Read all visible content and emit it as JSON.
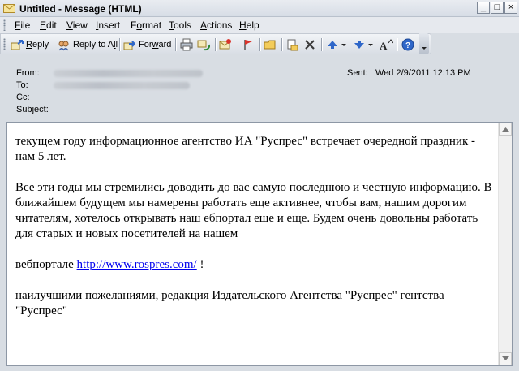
{
  "window": {
    "title": "Untitled - Message (HTML)",
    "controls": {
      "minimize": "_",
      "maximize": "□",
      "close": "×"
    }
  },
  "menu": {
    "items": [
      {
        "pre": "",
        "key": "F",
        "post": "ile"
      },
      {
        "pre": "",
        "key": "E",
        "post": "dit"
      },
      {
        "pre": "",
        "key": "V",
        "post": "iew"
      },
      {
        "pre": "",
        "key": "I",
        "post": "nsert"
      },
      {
        "pre": "F",
        "key": "o",
        "post": "rmat"
      },
      {
        "pre": "",
        "key": "T",
        "post": "ools"
      },
      {
        "pre": "",
        "key": "A",
        "post": "ctions"
      },
      {
        "pre": "",
        "key": "H",
        "post": "elp"
      }
    ]
  },
  "toolbar": {
    "reply": {
      "pre": "",
      "key": "R",
      "post": "eply"
    },
    "reply_all": {
      "pre": "Reply to A",
      "key": "l",
      "post": "l"
    },
    "forward": {
      "pre": "For",
      "key": "w",
      "post": "ard"
    }
  },
  "header": {
    "from_label": "From:",
    "to_label": "To:",
    "cc_label": "Cc:",
    "subject_label": "Subject:",
    "sent_label": "Sent:",
    "sent_value": "Wed 2/9/2011 12:13 PM"
  },
  "body": {
    "p1": "текущем году информационное агентство ИА \"Руспрес\" встречает очередной праздник - нам 5 лет.",
    "p2": "Все эти годы мы стремились доводить до вас самую последнюю и честную информацию. В ближайшем будущем мы намерены работать еще активнее, чтобы вам, нашим дорогим читателям, хотелось открывать наш ебпортал еще и еще. Будем очень довольны работать для старых и новых посетителей на нашем",
    "p3_prefix": "вебпортале",
    "p3_link": "http://www.rospres.com/",
    "p3_suffix": " !",
    "p4": "наилучшими пожеланиями, редакция Издательского Агентства \"Руспрес\" гентства \"Руспрес\""
  },
  "colors": {
    "window_bg": "#d8dde3",
    "link": "#0000ee"
  }
}
